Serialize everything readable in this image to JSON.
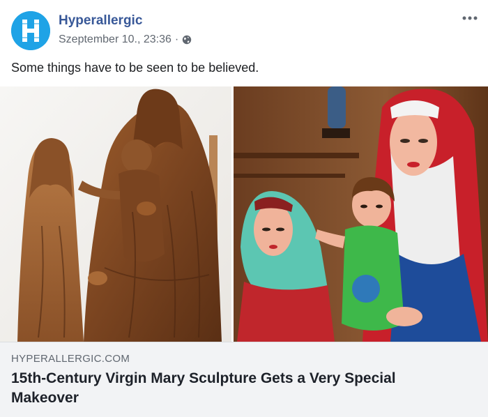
{
  "header": {
    "page_name": "Hyperallergic",
    "timestamp": "Szeptember 10., 23:36",
    "separator": "·",
    "privacy_icon": "globe-icon",
    "avatar_letter_icon": "hyperallergic-h-logo",
    "more_icon": "ellipsis-icon"
  },
  "post": {
    "text": "Some things have to be seen to be believed."
  },
  "media": {
    "left_image": "original wooden sculpture of two women and a child",
    "right_image": "repainted colorful sculpture of two women and a child"
  },
  "link": {
    "domain": "HYPERALLERGIC.COM",
    "title": "15th-Century Virgin Mary Sculpture Gets a Very Special Makeover"
  },
  "colors": {
    "brand_blue": "#1fa3e6",
    "name_link": "#385898",
    "meta_gray": "#606770",
    "preview_bg": "#f2f3f5"
  }
}
